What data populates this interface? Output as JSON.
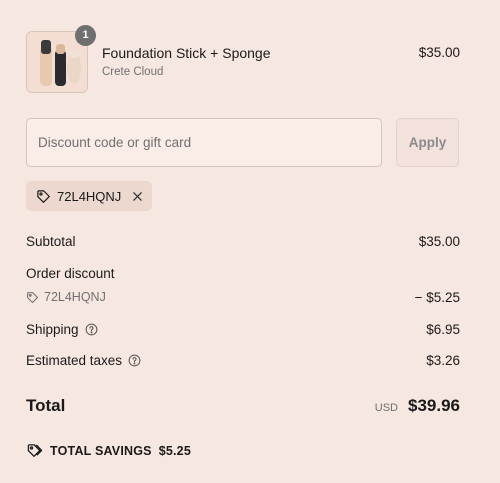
{
  "product": {
    "name": "Foundation Stick + Sponge",
    "variant": "Crete Cloud",
    "price": "$35.00",
    "quantity": "1"
  },
  "discount": {
    "placeholder": "Discount code or gift card",
    "apply_label": "Apply",
    "applied_code": "72L4HQNJ"
  },
  "summary": {
    "subtotal_label": "Subtotal",
    "subtotal_value": "$35.00",
    "order_discount_label": "Order discount",
    "order_discount_code": "72L4HQNJ",
    "order_discount_value": "− $5.25",
    "shipping_label": "Shipping",
    "shipping_value": "$6.95",
    "taxes_label": "Estimated taxes",
    "taxes_value": "$3.26",
    "total_label": "Total",
    "currency": "USD",
    "total_value": "$39.96",
    "savings_label": "TOTAL SAVINGS",
    "savings_value": "$5.25"
  },
  "colors": {
    "background": "#f7e7e1",
    "chip": "#ecd8cf",
    "badge": "#6f6f6f"
  }
}
